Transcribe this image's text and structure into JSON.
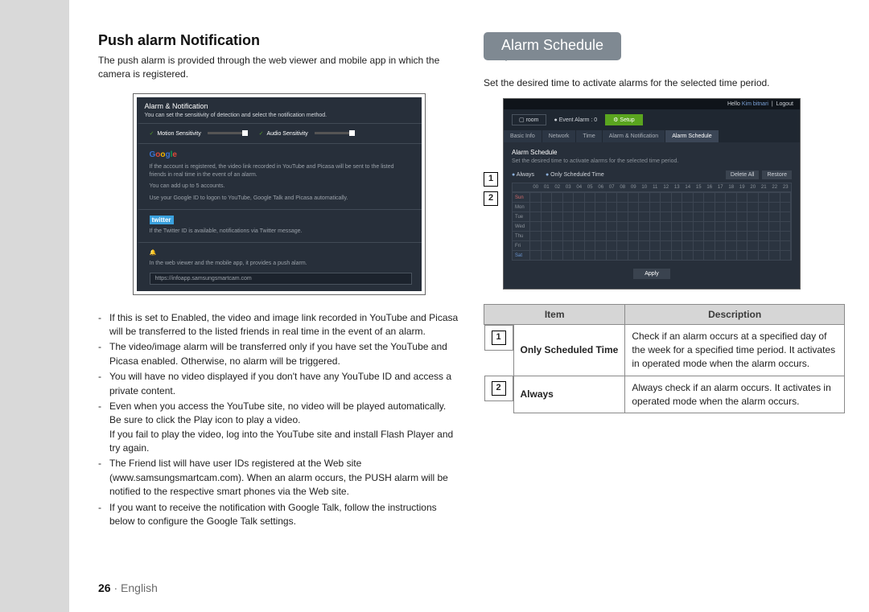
{
  "left": {
    "heading": "Push alarm Notification",
    "intro": "The push alarm is provided through the web viewer and mobile app in which the camera is registered.",
    "shot": {
      "title": "Alarm & Notification",
      "subtitle": "You can set the sensitivity of detection and select the notification method.",
      "motion_label": "Motion Sensitivity",
      "audio_label": "Audio Sensitivity",
      "google_desc1": "If the account is registered, the video link recorded in YouTube and Picasa will be sent to the listed friends in real time in the event of an alarm.",
      "google_desc2": "You can add up to 5 accounts.",
      "google_desc3": "Use your Google ID to logon to YouTube, Google Talk and Picasa automatically.",
      "twitter_desc": "If the Twitter ID is available, notifications via Twitter message.",
      "push_desc": "In the web viewer and the mobile app, it provides a push alarm.",
      "push_link": "https://infoapp.samsungsmartcam.com"
    },
    "bullets": [
      "If this is set to Enabled, the video and image link recorded in YouTube and Picasa will be transferred to the listed friends in real time in the event of an alarm.",
      "The video/image alarm will be transferred only if you have set the YouTube and Picasa enabled. Otherwise, no alarm will be triggered.",
      "You will have no video displayed if you don't have any YouTube ID and access a private content.",
      "Even when you access the YouTube site, no video will be played automatically. Be sure to click the Play icon to play a video.\nIf you fail to play the video, log into the YouTube site and install Flash Player and try again.",
      "The Friend list will have user IDs registered at the Web site (www.samsungsmartcam.com). When an alarm occurs, the PUSH alarm will be notified to the respective smart phones via the Web site.",
      "If you want to receive the notification with Google Talk, follow the instructions below to configure the Google Talk settings."
    ]
  },
  "right": {
    "tab": "Alarm Schedule",
    "intro": "Set the desired time to activate alarms for the selected time period.",
    "callouts": [
      "1",
      "2"
    ],
    "shot": {
      "hello": "Hello",
      "user": "Kim bitnari",
      "logout": "Logout",
      "room": "room",
      "event": "Event Alarm : 0",
      "setup": "Setup",
      "tabs": [
        "Basic Info",
        "Network",
        "Time",
        "Alarm & Notification",
        "Alarm Schedule"
      ],
      "panel_title": "Alarm Schedule",
      "panel_sub": "Set the desired time to activate alarms for the selected time period.",
      "radio_always": "Always",
      "radio_sched": "Only Scheduled Time",
      "btn_delete": "Delete All",
      "btn_restore": "Restore",
      "hours": [
        "00",
        "01",
        "02",
        "03",
        "04",
        "05",
        "06",
        "07",
        "08",
        "09",
        "10",
        "11",
        "12",
        "13",
        "14",
        "15",
        "16",
        "17",
        "18",
        "19",
        "20",
        "21",
        "22",
        "23"
      ],
      "days": [
        "Sun",
        "Mon",
        "Tue",
        "Wed",
        "Thu",
        "Fri",
        "Sat"
      ],
      "apply": "Apply"
    },
    "table": {
      "head_item": "Item",
      "head_desc": "Description",
      "rows": [
        {
          "num": "1",
          "item": "Only Scheduled Time",
          "desc": "Check if an alarm occurs at a specified day of the week for a specified time period. It activates in operated mode when the alarm occurs."
        },
        {
          "num": "2",
          "item": "Always",
          "desc": "Always check if an alarm occurs. It activates in operated mode when the alarm occurs."
        }
      ]
    }
  },
  "footer": {
    "page": "26",
    "sep": " · ",
    "lang": "English"
  }
}
